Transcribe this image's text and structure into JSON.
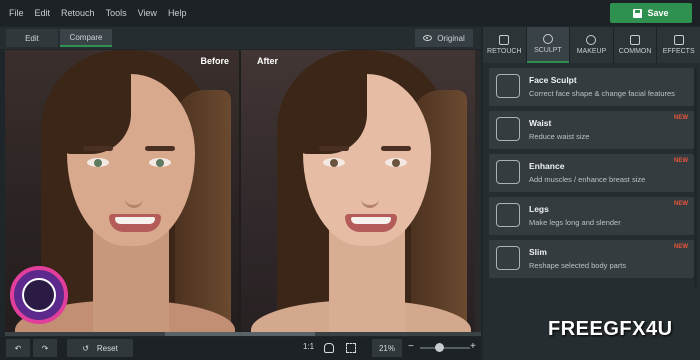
{
  "menu": [
    "File",
    "Edit",
    "Retouch",
    "Tools",
    "View",
    "Help"
  ],
  "save_label": "Save",
  "view_tabs": {
    "edit": "Edit",
    "compare": "Compare"
  },
  "original_label": "Original",
  "canvas": {
    "before_label": "Before",
    "after_label": "After"
  },
  "bottom": {
    "reset_label": "Reset",
    "ratio_label": "1:1",
    "zoom": "21%",
    "zoom_level": 0.38
  },
  "right_tabs": [
    {
      "label": "RETOUCH",
      "icon": "retouch-icon"
    },
    {
      "label": "SCULPT",
      "icon": "sculpt-icon",
      "active": true
    },
    {
      "label": "MAKEUP",
      "icon": "makeup-icon"
    },
    {
      "label": "COMMON",
      "icon": "sliders-icon"
    },
    {
      "label": "EFFECTS",
      "icon": "effects-icon"
    }
  ],
  "tools": [
    {
      "title": "Face Sculpt",
      "desc": "Correct face shape & change facial features",
      "badge": ""
    },
    {
      "title": "Waist",
      "desc": "Reduce waist size",
      "badge": "NEW"
    },
    {
      "title": "Enhance",
      "desc": "Add muscles / enhance breast size",
      "badge": "NEW"
    },
    {
      "title": "Legs",
      "desc": "Make legs long and slender",
      "badge": "NEW"
    },
    {
      "title": "Slim",
      "desc": "Reshape selected body parts",
      "badge": "NEW"
    }
  ],
  "watermark": "FREEGFX4U",
  "colors": {
    "accent": "#2e9150",
    "new_badge": "#e8553a"
  }
}
